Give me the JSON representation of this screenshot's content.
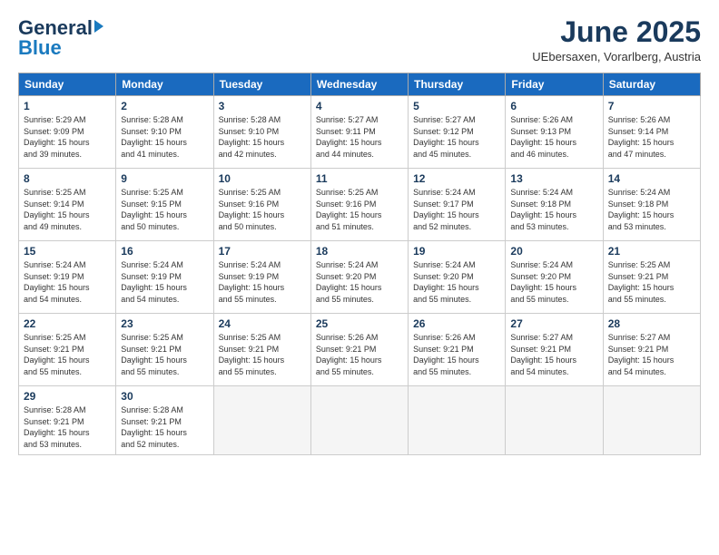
{
  "logo": {
    "general": "General",
    "blue": "Blue"
  },
  "title": "June 2025",
  "subtitle": "UEbersaxen, Vorarlberg, Austria",
  "weekdays": [
    "Sunday",
    "Monday",
    "Tuesday",
    "Wednesday",
    "Thursday",
    "Friday",
    "Saturday"
  ],
  "weeks": [
    [
      {
        "day": "1",
        "info": "Sunrise: 5:29 AM\nSunset: 9:09 PM\nDaylight: 15 hours\nand 39 minutes."
      },
      {
        "day": "2",
        "info": "Sunrise: 5:28 AM\nSunset: 9:10 PM\nDaylight: 15 hours\nand 41 minutes."
      },
      {
        "day": "3",
        "info": "Sunrise: 5:28 AM\nSunset: 9:10 PM\nDaylight: 15 hours\nand 42 minutes."
      },
      {
        "day": "4",
        "info": "Sunrise: 5:27 AM\nSunset: 9:11 PM\nDaylight: 15 hours\nand 44 minutes."
      },
      {
        "day": "5",
        "info": "Sunrise: 5:27 AM\nSunset: 9:12 PM\nDaylight: 15 hours\nand 45 minutes."
      },
      {
        "day": "6",
        "info": "Sunrise: 5:26 AM\nSunset: 9:13 PM\nDaylight: 15 hours\nand 46 minutes."
      },
      {
        "day": "7",
        "info": "Sunrise: 5:26 AM\nSunset: 9:14 PM\nDaylight: 15 hours\nand 47 minutes."
      }
    ],
    [
      {
        "day": "8",
        "info": "Sunrise: 5:25 AM\nSunset: 9:14 PM\nDaylight: 15 hours\nand 49 minutes."
      },
      {
        "day": "9",
        "info": "Sunrise: 5:25 AM\nSunset: 9:15 PM\nDaylight: 15 hours\nand 50 minutes."
      },
      {
        "day": "10",
        "info": "Sunrise: 5:25 AM\nSunset: 9:16 PM\nDaylight: 15 hours\nand 50 minutes."
      },
      {
        "day": "11",
        "info": "Sunrise: 5:25 AM\nSunset: 9:16 PM\nDaylight: 15 hours\nand 51 minutes."
      },
      {
        "day": "12",
        "info": "Sunrise: 5:24 AM\nSunset: 9:17 PM\nDaylight: 15 hours\nand 52 minutes."
      },
      {
        "day": "13",
        "info": "Sunrise: 5:24 AM\nSunset: 9:18 PM\nDaylight: 15 hours\nand 53 minutes."
      },
      {
        "day": "14",
        "info": "Sunrise: 5:24 AM\nSunset: 9:18 PM\nDaylight: 15 hours\nand 53 minutes."
      }
    ],
    [
      {
        "day": "15",
        "info": "Sunrise: 5:24 AM\nSunset: 9:19 PM\nDaylight: 15 hours\nand 54 minutes."
      },
      {
        "day": "16",
        "info": "Sunrise: 5:24 AM\nSunset: 9:19 PM\nDaylight: 15 hours\nand 54 minutes."
      },
      {
        "day": "17",
        "info": "Sunrise: 5:24 AM\nSunset: 9:19 PM\nDaylight: 15 hours\nand 55 minutes."
      },
      {
        "day": "18",
        "info": "Sunrise: 5:24 AM\nSunset: 9:20 PM\nDaylight: 15 hours\nand 55 minutes."
      },
      {
        "day": "19",
        "info": "Sunrise: 5:24 AM\nSunset: 9:20 PM\nDaylight: 15 hours\nand 55 minutes."
      },
      {
        "day": "20",
        "info": "Sunrise: 5:24 AM\nSunset: 9:20 PM\nDaylight: 15 hours\nand 55 minutes."
      },
      {
        "day": "21",
        "info": "Sunrise: 5:25 AM\nSunset: 9:21 PM\nDaylight: 15 hours\nand 55 minutes."
      }
    ],
    [
      {
        "day": "22",
        "info": "Sunrise: 5:25 AM\nSunset: 9:21 PM\nDaylight: 15 hours\nand 55 minutes."
      },
      {
        "day": "23",
        "info": "Sunrise: 5:25 AM\nSunset: 9:21 PM\nDaylight: 15 hours\nand 55 minutes."
      },
      {
        "day": "24",
        "info": "Sunrise: 5:25 AM\nSunset: 9:21 PM\nDaylight: 15 hours\nand 55 minutes."
      },
      {
        "day": "25",
        "info": "Sunrise: 5:26 AM\nSunset: 9:21 PM\nDaylight: 15 hours\nand 55 minutes."
      },
      {
        "day": "26",
        "info": "Sunrise: 5:26 AM\nSunset: 9:21 PM\nDaylight: 15 hours\nand 55 minutes."
      },
      {
        "day": "27",
        "info": "Sunrise: 5:27 AM\nSunset: 9:21 PM\nDaylight: 15 hours\nand 54 minutes."
      },
      {
        "day": "28",
        "info": "Sunrise: 5:27 AM\nSunset: 9:21 PM\nDaylight: 15 hours\nand 54 minutes."
      }
    ],
    [
      {
        "day": "29",
        "info": "Sunrise: 5:28 AM\nSunset: 9:21 PM\nDaylight: 15 hours\nand 53 minutes."
      },
      {
        "day": "30",
        "info": "Sunrise: 5:28 AM\nSunset: 9:21 PM\nDaylight: 15 hours\nand 52 minutes."
      },
      {
        "day": "",
        "info": ""
      },
      {
        "day": "",
        "info": ""
      },
      {
        "day": "",
        "info": ""
      },
      {
        "day": "",
        "info": ""
      },
      {
        "day": "",
        "info": ""
      }
    ]
  ]
}
